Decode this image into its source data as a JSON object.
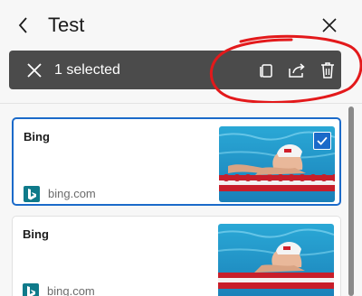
{
  "header": {
    "title": "Test"
  },
  "selection_bar": {
    "label": "1 selected"
  },
  "items": [
    {
      "title": "Bing",
      "source": "bing.com",
      "selected": true
    },
    {
      "title": "Bing",
      "source": "bing.com",
      "selected": false
    }
  ],
  "colors": {
    "accent": "#1b6ac9",
    "selection_bar_bg": "#4b4b4b",
    "annotation": "#e3191b",
    "bing_teal": "#0f7a8a"
  },
  "icons": [
    "back-icon",
    "close-icon",
    "copy-icon",
    "share-icon",
    "delete-icon",
    "bing-logo-icon",
    "checkmark-icon"
  ]
}
